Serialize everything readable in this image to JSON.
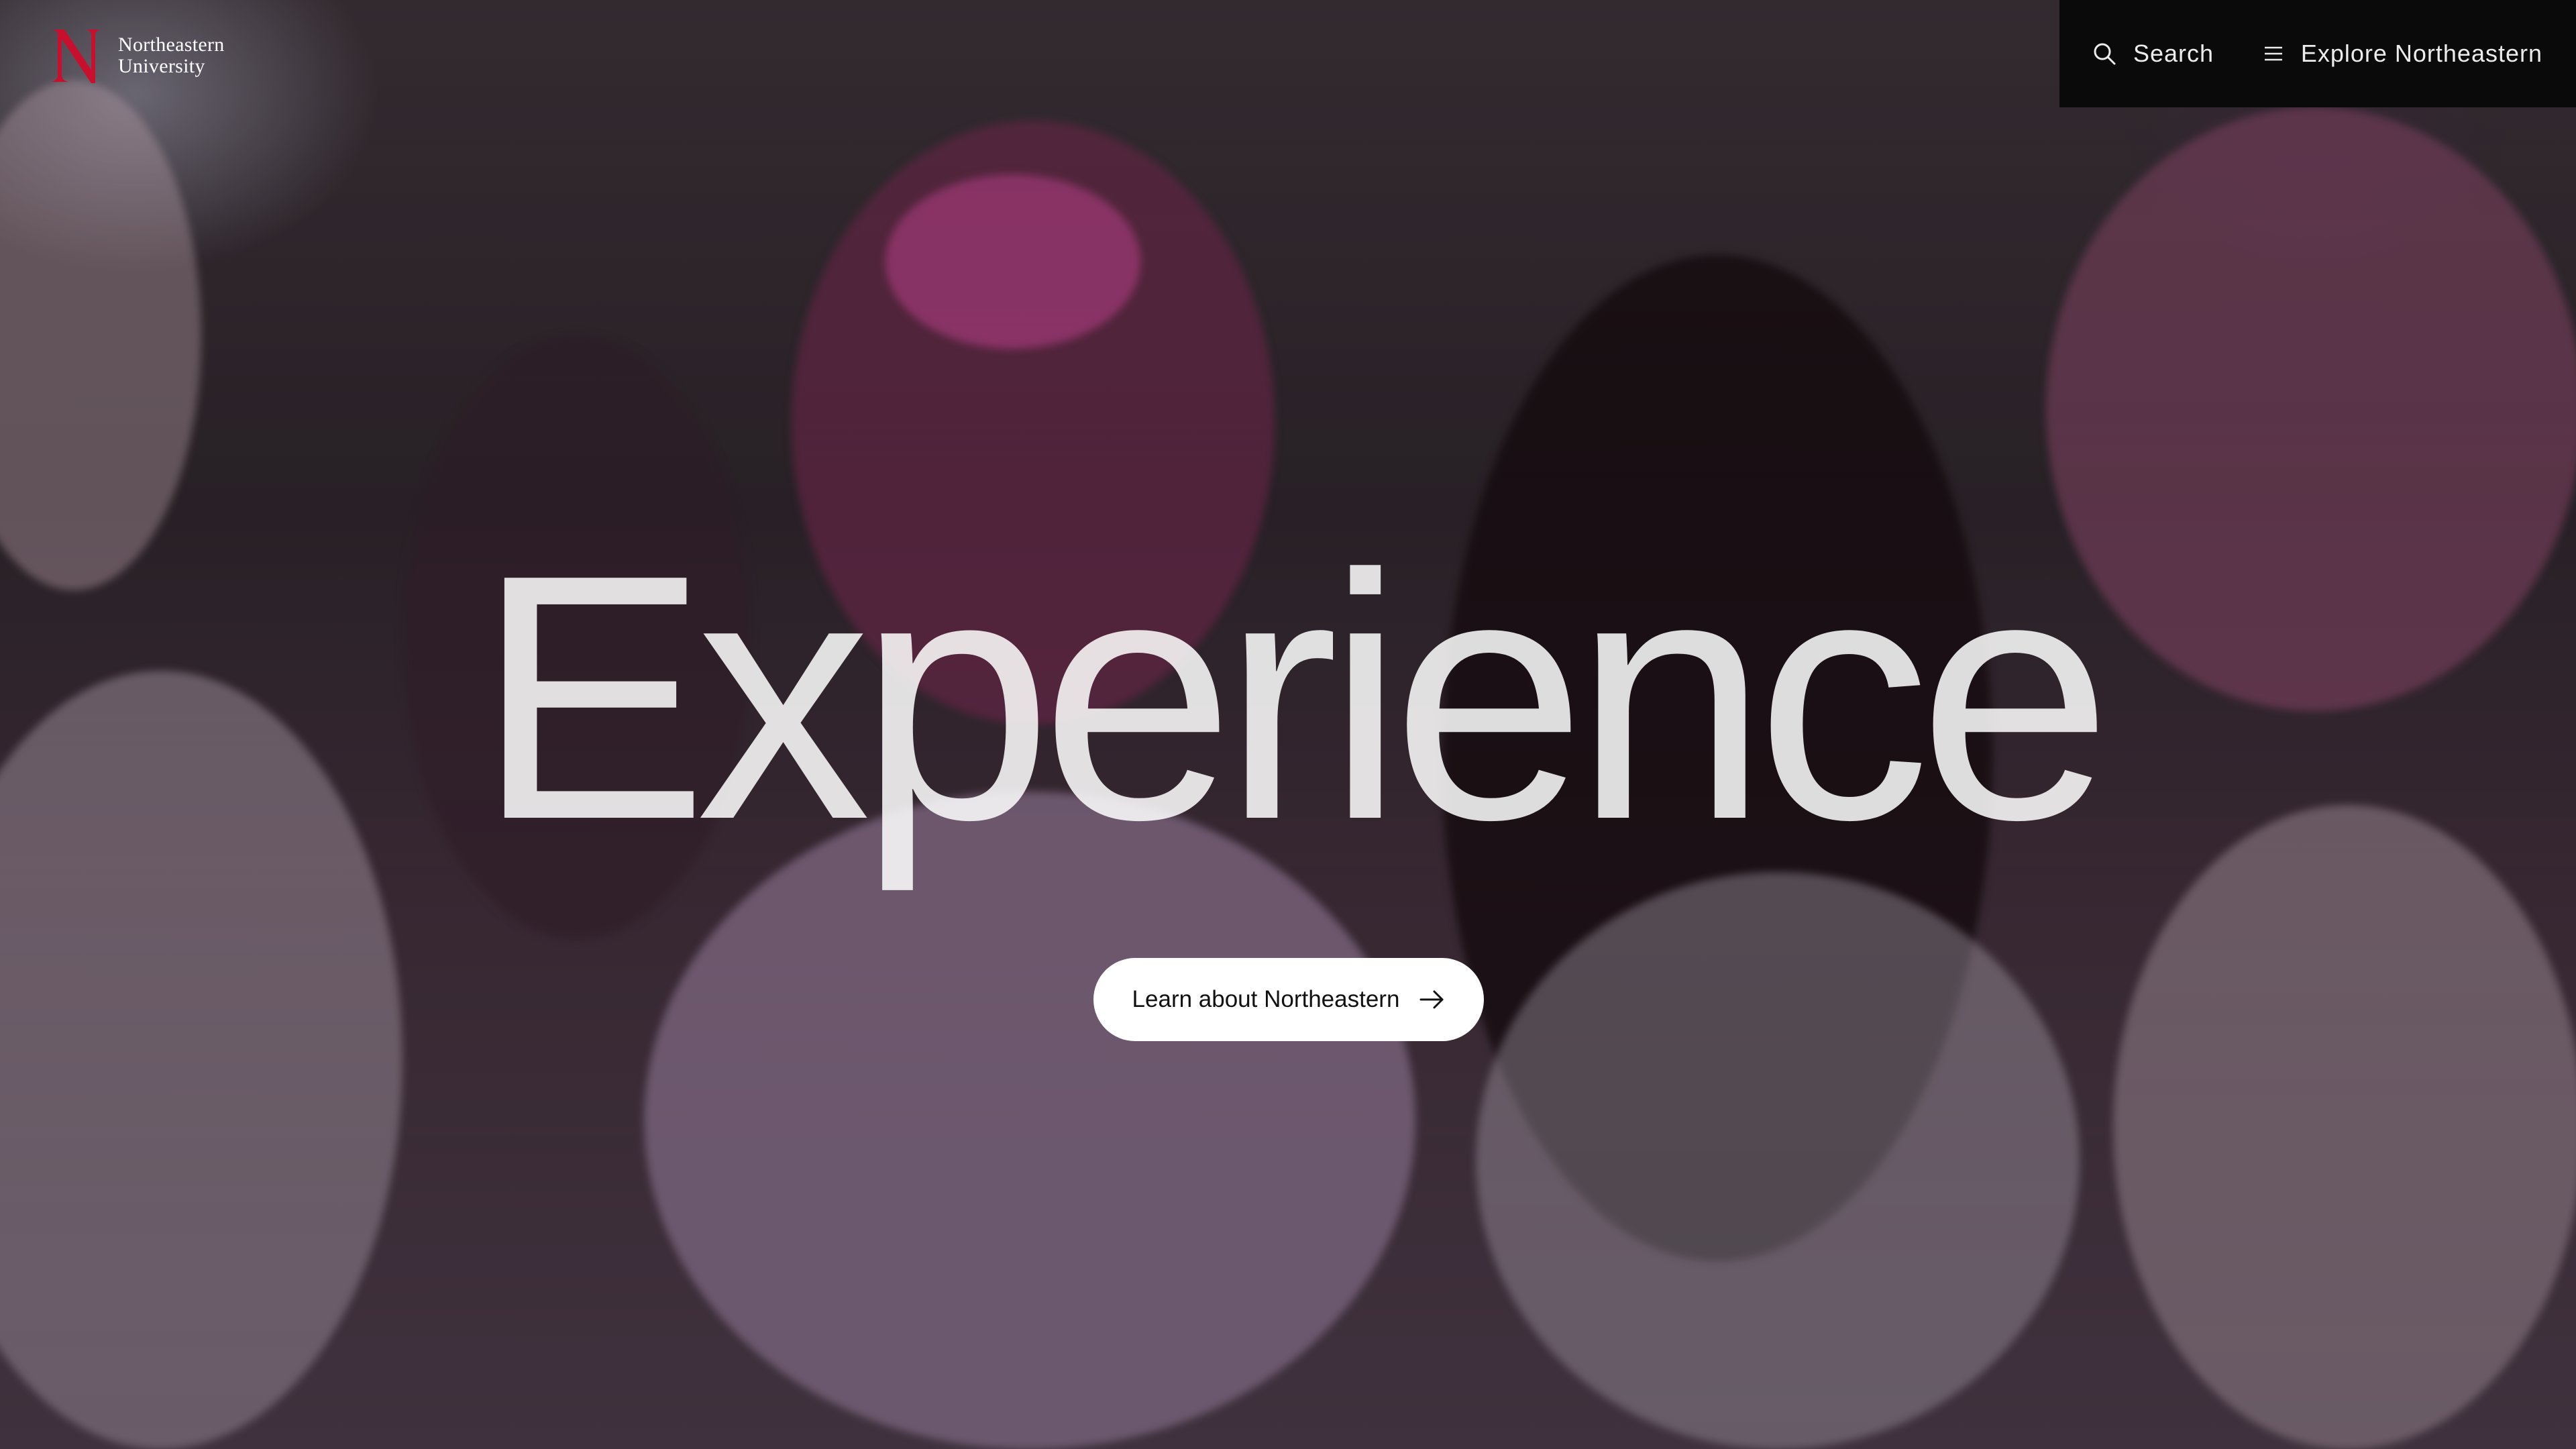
{
  "brand": {
    "line1": "Northeastern",
    "line2": "University",
    "accent": "#c8102e"
  },
  "topnav": {
    "search_label": "Search",
    "explore_label": "Explore Northeastern",
    "background": "#0b0a0b",
    "icons": {
      "search": "search-icon",
      "menu": "menu-icon"
    }
  },
  "hero": {
    "headline": "Experience",
    "cta_label": "Learn about Northeastern",
    "cta_icon": "arrow-right-icon",
    "photo": "students-covered-in-colored-powder-photo"
  }
}
